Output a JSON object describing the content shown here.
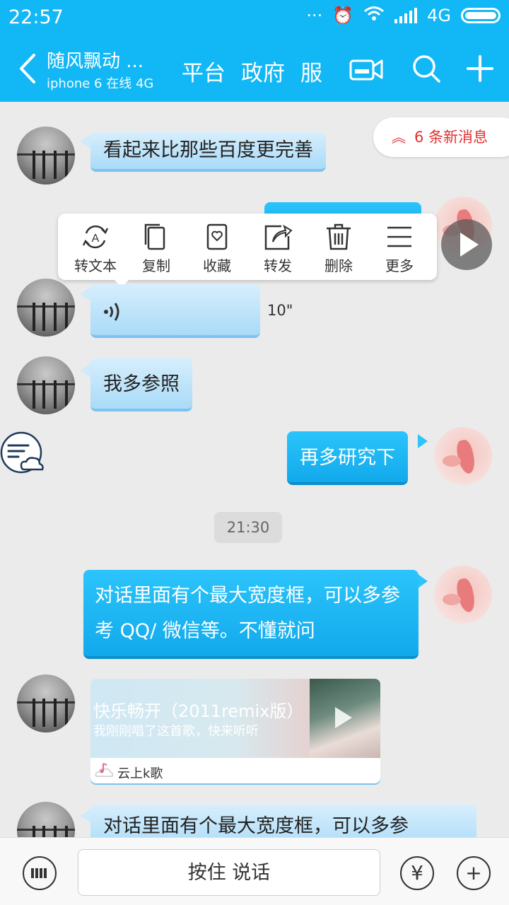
{
  "status": {
    "time": "22:57",
    "network": "4G"
  },
  "header": {
    "title": "随风飘动 ...",
    "subtitle": "iphone 6 在线  4G",
    "nav": [
      "平台",
      "政府",
      "服"
    ]
  },
  "chat": {
    "new_messages": "6 条新消息",
    "msg1": "看起来比那些百度更完善",
    "voice_duration": "10\"",
    "msg3": "我多参照",
    "msg4": "再多研究下",
    "timestamp": "21:30",
    "msg5": "对话里面有个最大宽度框，可以多参考 QQ/ 微信等。不懂就问",
    "music": {
      "title": "快乐畅开（2011remix版）",
      "subtitle": "我刚刚唱了这首歌，快来听听",
      "source": "云上k歌"
    },
    "msg6": "对话里面有个最大宽度框，可以多参"
  },
  "context_menu": [
    {
      "label": "转文本",
      "icon": "convert-text-icon"
    },
    {
      "label": "复制",
      "icon": "copy-icon"
    },
    {
      "label": "收藏",
      "icon": "favorite-icon"
    },
    {
      "label": "转发",
      "icon": "forward-icon"
    },
    {
      "label": "删除",
      "icon": "delete-icon"
    },
    {
      "label": "更多",
      "icon": "more-icon"
    }
  ],
  "bottom": {
    "talk_label": "按住 说话"
  },
  "colors": {
    "brand": "#12b7f5",
    "alert": "#e23232"
  }
}
